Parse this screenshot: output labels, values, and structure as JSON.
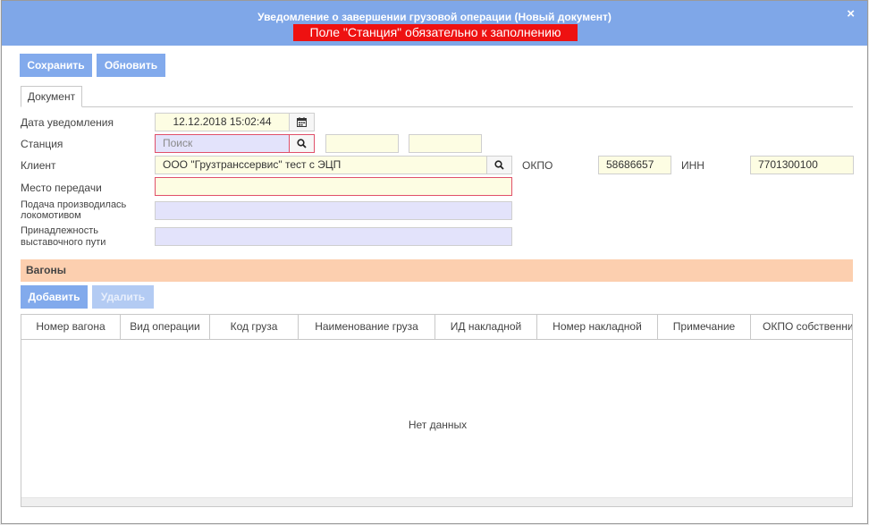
{
  "window": {
    "title": "Уведомление о завершении грузовой операции (Новый документ)",
    "error": "Поле \"Станция\" обязательно к заполнению",
    "close_glyph": "×"
  },
  "toolbar": {
    "save_label": "Сохранить",
    "refresh_label": "Обновить"
  },
  "tabs": [
    {
      "label": "Документ"
    }
  ],
  "form": {
    "date_label": "Дата уведомления",
    "date_value": "12.12.2018 15:02:44",
    "station_label": "Станция",
    "station_placeholder": "Поиск",
    "client_label": "Клиент",
    "client_value": "ООО \"Грузтранссервис\"  тест с ЭЦП",
    "okpo_label": "ОКПО",
    "okpo_value": "58686657",
    "inn_label": "ИНН",
    "inn_value": "7701300100",
    "place_label": "Место передачи",
    "loco_label_1": "Подача производилась",
    "loco_label_2": "локомотивом",
    "track_label_1": "Принадлежность",
    "track_label_2": "выставочного пути"
  },
  "wagons": {
    "section_title": "Вагоны",
    "add_label": "Добавить",
    "delete_label": "Удалить",
    "columns": [
      "Номер вагона",
      "Вид операции",
      "Код груза",
      "Наименование груза",
      "ИД накладной",
      "Номер накладной",
      "Примечание",
      "ОКПО собственника"
    ],
    "empty_text": "Нет данных"
  },
  "icons": {
    "calendar": "calendar-icon",
    "search": "search-icon",
    "close": "close-icon"
  },
  "colors": {
    "titlebar": "#7fa7e8",
    "error": "#ee1111",
    "button": "#82aaec",
    "section": "#fccfaf",
    "required_field": "#fdfde3",
    "optional_field": "#e3e3fb",
    "invalid_border": "#e0506a"
  }
}
